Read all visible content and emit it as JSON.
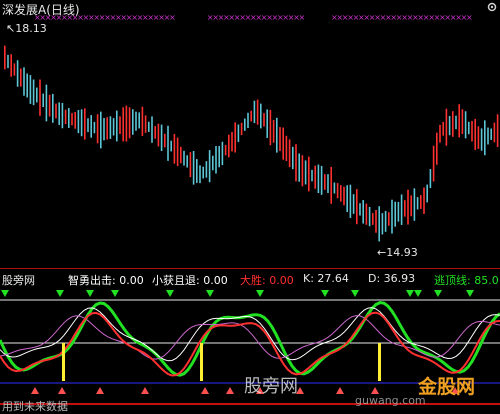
{
  "header": {
    "title": "深发展A(日线)",
    "price_high": "18.13",
    "price_low": "14.93"
  },
  "indicator_bar": {
    "source": "股旁网",
    "zhiyong_label": "智勇出击: 0.00",
    "xiaohuo_label": "小获且退: 0.00",
    "dasheng_label": "大胜: 0.00",
    "k_label": "K: 27.64",
    "d_label": "D: 36.93",
    "taoding_label": "逃顶线: 85.0"
  },
  "watermark": {
    "site_cn": "股旁网",
    "site_url": "guwang.com",
    "brand": "金股网"
  },
  "footer": {
    "text": "用到未来数据"
  },
  "colors": {
    "up": "#ff3030",
    "down": "#5cc6d6",
    "green": "#22e022",
    "divider": "#b01010",
    "marker": "#cc33cc"
  },
  "icons": {
    "settings": "gear-icon",
    "arrow": "arrow-left-icon"
  }
}
